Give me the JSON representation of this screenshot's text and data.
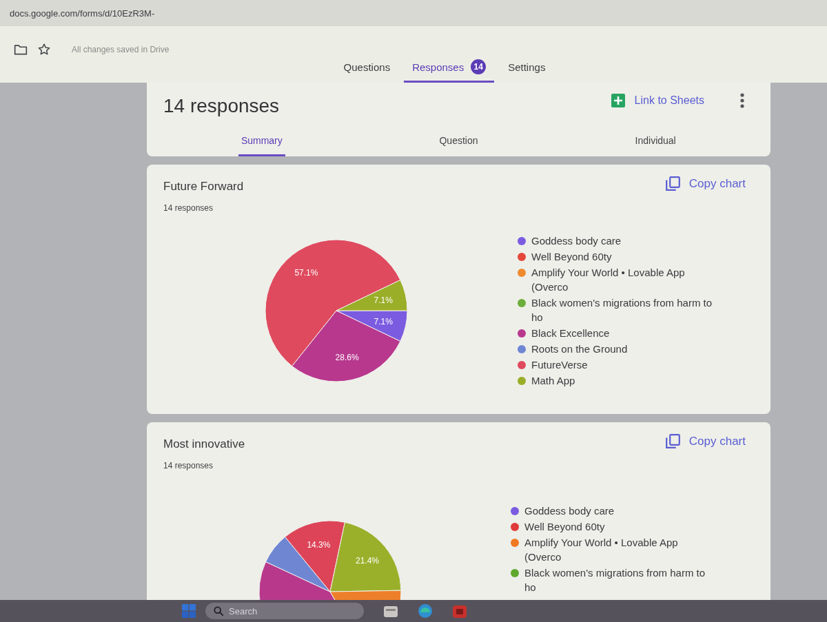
{
  "browser": {
    "address": "docs.google.com/forms/d/10EzR3M-"
  },
  "toolbar": {
    "save_status": "All changes saved in Drive",
    "tabs": [
      {
        "label": "Questions",
        "selected": false
      },
      {
        "label": "Responses",
        "selected": true,
        "badge": "14"
      },
      {
        "label": "Settings",
        "selected": false
      }
    ]
  },
  "summary": {
    "title": "14 responses",
    "link": "Link to Sheets",
    "views": [
      {
        "label": "Summary",
        "selected": true
      },
      {
        "label": "Question",
        "selected": false
      },
      {
        "label": "Individual",
        "selected": false
      }
    ]
  },
  "questions": [
    {
      "kind": "chart",
      "title": "Future Forward",
      "count": "14 responses",
      "action": "Copy chart",
      "chart_data": {
        "type": "pie",
        "categories": [
          "Goddess body care",
          "Well Beyond 60ty",
          "Amplify Your World • Lovable App (Overco",
          "Black women's migrations from harm to ho",
          "Black Excellence",
          "Roots on the Ground",
          "FutureVerse",
          "Math App"
        ],
        "values": [
          7.1,
          0,
          0,
          0,
          28.6,
          0,
          57.1,
          7.1
        ],
        "colors": [
          "#7b5ce0",
          "#e5473b",
          "#ef8a2e",
          "#6cae3c",
          "#b8388e",
          "#6f86d3",
          "#df4a5e",
          "#9aae28"
        ],
        "value_labels": [
          "7.1%",
          null,
          null,
          null,
          "28.6%",
          null,
          "57.1%",
          "7.1%"
        ]
      }
    },
    {
      "kind": "cutoff",
      "title": "Most innovative",
      "count": "14 responses",
      "action": "Copy chart",
      "slice_labels": [
        "14.3%",
        "21.4%"
      ],
      "legend": [
        {
          "label": "Goddess body care",
          "color": "#7b5ce0"
        },
        {
          "label": "Well Beyond 60ty",
          "color": "#e03a3a"
        },
        {
          "label": "Amplify Your World • Lovable App (Overco",
          "color": "#ef7a22"
        },
        {
          "label": "Black women's migrations from harm to ho",
          "color": "#5fa82e"
        }
      ]
    }
  ],
  "taskbar": {
    "search": {
      "placeholder": "Search"
    }
  }
}
